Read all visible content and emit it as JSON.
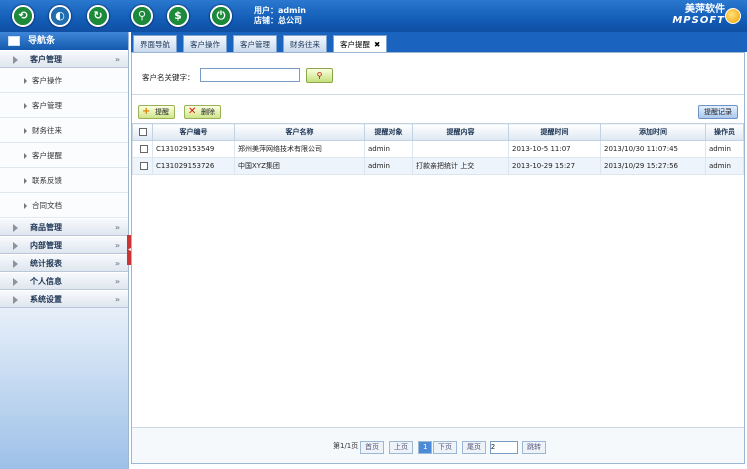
{
  "toolbar_icons": [
    {
      "name": "home-icon",
      "glyph": "⟲",
      "color": "#1c8a3a"
    },
    {
      "name": "customer-icon",
      "glyph": "◐",
      "color": "#1f6fb0"
    },
    {
      "name": "refresh-icon",
      "glyph": "↻",
      "color": "#1c8a3a"
    },
    {
      "name": "search-icon",
      "glyph": "⚲",
      "color": "#1c8a3a"
    },
    {
      "name": "money-icon",
      "glyph": "$",
      "color": "#1c8a3a"
    },
    {
      "name": "power-icon",
      "glyph": "⏻",
      "color": "#1c8a3a"
    }
  ],
  "user": {
    "label": "用户：admin",
    "store": "店铺：总公司"
  },
  "brand": {
    "cn": "美萍软件",
    "en": "MPSOFT"
  },
  "sidebar": {
    "title": "导航条",
    "groups": [
      {
        "label": "客户管理",
        "expanded": true,
        "items": [
          "客户操作",
          "客户管理",
          "财务往来",
          "客户提醒",
          "联系反馈",
          "合同文档"
        ]
      },
      {
        "label": "商品管理"
      },
      {
        "label": "内部管理"
      },
      {
        "label": "统计报表"
      },
      {
        "label": "个人信息"
      },
      {
        "label": "系统设置"
      }
    ]
  },
  "tabs": [
    "界面导航",
    "客户操作",
    "客户管理",
    "财务往来",
    "客户提醒"
  ],
  "active_tab": "客户提醒",
  "search": {
    "label": "客户名关键字：",
    "value": ""
  },
  "actions": {
    "add": "提醒",
    "delete": "删除",
    "records": "提醒记录"
  },
  "table": {
    "columns": [
      "客户编号",
      "客户名称",
      "提醒对象",
      "提醒内容",
      "提醒时间",
      "添加时间",
      "操作员"
    ],
    "rows": [
      [
        "C131029153549",
        "郑州美萍网络技术有限公司",
        "admin",
        "",
        "2013-10-5 11:07",
        "2013/10/30 11:07:45",
        "admin"
      ],
      [
        "C131029153726",
        "中国XYZ集团",
        "admin",
        "打款亲把统计 上交",
        "2013-10-29 15:27",
        "2013/10/29 15:27:56",
        "admin"
      ]
    ]
  },
  "pager": {
    "info": "第1/1页",
    "first": "首页",
    "prev": "上页",
    "current": "1",
    "next": "下页",
    "last": "尾页",
    "input": "2",
    "go": "跳转"
  }
}
